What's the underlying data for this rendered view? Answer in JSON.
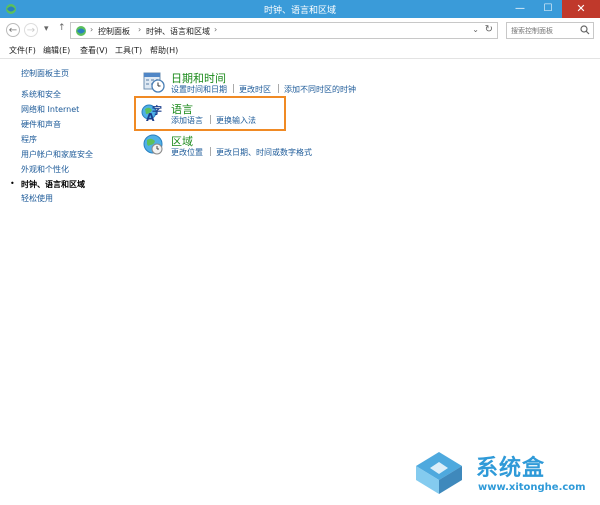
{
  "window": {
    "title": "时钟、语言和区域",
    "minimize": "—",
    "maximize": "☐",
    "close": "✕"
  },
  "nav": {
    "back": "←",
    "forward": "→",
    "dropdown": "▾",
    "up": "↑"
  },
  "address": {
    "breadcrumbs": [
      "控制面板",
      "时钟、语言和区域"
    ],
    "separator": "›",
    "dropdown": "⌄",
    "refresh": "↻"
  },
  "search": {
    "placeholder": "搜索控制面板"
  },
  "menu": [
    "文件(F)",
    "编辑(E)",
    "查看(V)",
    "工具(T)",
    "帮助(H)"
  ],
  "sidebar": {
    "items": [
      "控制面板主页",
      "系统和安全",
      "网络和 Internet",
      "硬件和声音",
      "程序",
      "用户帐户和家庭安全",
      "外观和个性化",
      "时钟、语言和区域",
      "轻松使用"
    ],
    "bullet": "•"
  },
  "categories": {
    "datetime": {
      "title": "日期和时间",
      "links": [
        "设置时间和日期",
        "更改时区",
        "添加不同时区的时钟"
      ]
    },
    "language": {
      "title": "语言",
      "links": [
        "添加语言",
        "更换输入法"
      ]
    },
    "region": {
      "title": "区域",
      "links": [
        "更改位置",
        "更改日期、时间或数字格式"
      ]
    }
  },
  "watermark": {
    "text": "系统盒",
    "url": "www.xitonghe.com"
  },
  "colors": {
    "titlebar": "#3a9bd9",
    "link": "#1e5b99",
    "category": "#1b8a1b",
    "highlight": "#f08a24",
    "watermark": "#2f9ad8"
  }
}
